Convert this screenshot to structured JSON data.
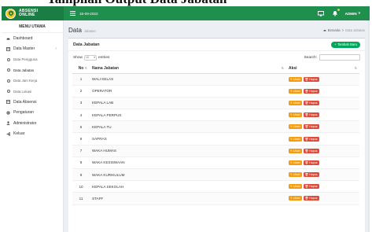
{
  "caption": "Tampilan Output Data Jabatan",
  "header": {
    "brand_top": "ABSENSI",
    "brand_bottom": "ONLINE",
    "date": "15-09-2022",
    "user": "ADMIN"
  },
  "sidebar": {
    "title": "MENU UTAMA",
    "items": [
      {
        "label": "Dashboard",
        "icon": "dashboard-icon"
      },
      {
        "label": "Data Master",
        "icon": "table-icon"
      },
      {
        "label": "Data Pengguna"
      },
      {
        "label": "Data Jabatan"
      },
      {
        "label": "Data Jam Kerja"
      },
      {
        "label": "Data Lokasi"
      },
      {
        "label": "Data Absensi",
        "icon": "table-icon"
      },
      {
        "label": "Pengaturan",
        "icon": "gears-icon"
      },
      {
        "label": "Administrator",
        "icon": "user-icon"
      },
      {
        "label": "Keluar",
        "icon": "sign-out-icon"
      }
    ]
  },
  "page": {
    "title": "Data",
    "subtitle": "Jabatan",
    "breadcrumb_home": "Beranda",
    "breadcrumb_current": "Data Jabatan"
  },
  "box": {
    "title": "Data Jabatan",
    "add_label": "Tambah Baru",
    "show_label": "Show",
    "entries_value": "10",
    "entries_label": "entries",
    "search_label": "Search:"
  },
  "table": {
    "headers": {
      "no": "No",
      "name": "Nama Jabatan",
      "action": "Aksi"
    },
    "edit_label": "Ubah",
    "delete_label": "Hapus",
    "rows": [
      {
        "no": "1",
        "name": "WALI KELAS"
      },
      {
        "no": "2",
        "name": "OPERATOR"
      },
      {
        "no": "3",
        "name": "KEPALA LAB"
      },
      {
        "no": "4",
        "name": "KEPALA PERPUS"
      },
      {
        "no": "5",
        "name": "KEPALA TU"
      },
      {
        "no": "6",
        "name": "SAPRAS"
      },
      {
        "no": "7",
        "name": "WAKA HUMAS"
      },
      {
        "no": "8",
        "name": "WAKA KESISWAAN"
      },
      {
        "no": "9",
        "name": "WAKA KURIKULUM"
      },
      {
        "no": "10",
        "name": "KEPALA SEKOLAH"
      },
      {
        "no": "11",
        "name": "STAFF"
      }
    ]
  },
  "colors": {
    "topbar": "#1f8f4d",
    "accent_green": "#00a65a",
    "edit": "#f39c12",
    "delete": "#dd4b39"
  }
}
